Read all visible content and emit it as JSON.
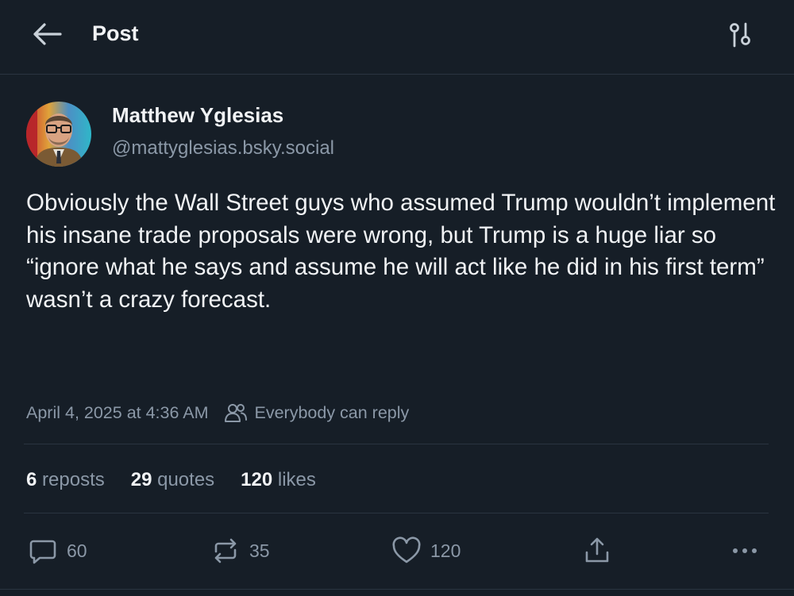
{
  "header": {
    "title": "Post",
    "back_icon": "arrow-left-icon",
    "settings_icon": "sliders-icon"
  },
  "author": {
    "display_name": "Matthew Yglesias",
    "handle": "@mattyglesias.bsky.social"
  },
  "post": {
    "text": "Obviously the Wall Street guys who assumed Trump wouldn’t implement his insane trade proposals were wrong, but Trump is a huge liar so “ignore what he says and assume he will act like he did in his first term” wasn’t a crazy forecast.",
    "timestamp": "April 4, 2025 at 4:36 AM",
    "reply_setting": "Everybody can reply"
  },
  "stats": {
    "reposts": {
      "count": "6",
      "label": "reposts"
    },
    "quotes": {
      "count": "29",
      "label": "quotes"
    },
    "likes": {
      "count": "120",
      "label": "likes"
    }
  },
  "actions": {
    "reply_count": "60",
    "repost_count": "35",
    "like_count": "120"
  },
  "colors": {
    "background": "#161e27",
    "text_primary": "#f1f3f5",
    "text_secondary": "#8b98a7",
    "divider": "#2a3440"
  }
}
